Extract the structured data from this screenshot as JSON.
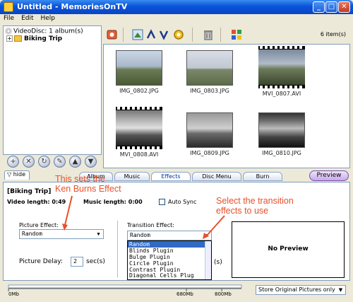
{
  "window": {
    "title": "Untitled - MemoriesOnTV"
  },
  "menu": [
    "File",
    "Edit",
    "Help"
  ],
  "tree": {
    "root": "VideoDisc: 1 album(s)",
    "album": "Biking Trip"
  },
  "toolbar": {
    "item_count": "6 item(s)"
  },
  "thumbnails": [
    {
      "name": "IMG_0802.JPG",
      "type": "photo"
    },
    {
      "name": "IMG_0803.JPG",
      "type": "photo"
    },
    {
      "name": "MVI_0807.AVI",
      "type": "video"
    },
    {
      "name": "MVI_0808.AVI",
      "type": "video"
    },
    {
      "name": "IMG_0809.JPG",
      "type": "photo"
    },
    {
      "name": "IMG_0810.JPG",
      "type": "photo"
    }
  ],
  "hide_tab": "hide",
  "tabs": [
    "Album",
    "Music",
    "Effects",
    "Disc Menu",
    "Burn"
  ],
  "active_tab": "Effects",
  "preview_button": "Preview",
  "album_panel": {
    "title": "[Biking Trip]",
    "video_length": "Video length: 0:49",
    "music_length": "Music length: 0:00",
    "auto_sync": "Auto Sync"
  },
  "effects": {
    "picture_effect_label": "Picture Effect:",
    "picture_effect_value": "Random",
    "picture_delay_label": "Picture Delay:",
    "picture_delay_value": "2",
    "picture_delay_unit": "sec(s)",
    "transition_effect_label": "Transition Effect:",
    "transition_effect_value": "Random",
    "transition_options": [
      "Random",
      "Blinds Plugin",
      "Bulge Plugin",
      "Circle Plugin",
      "Contrast Plugin",
      "Diagonal Cells Plug"
    ],
    "transition_suffix": "(s)",
    "no_preview": "No Preview"
  },
  "capacity": {
    "ticks": [
      "0Mb",
      "680Mb",
      "800Mb"
    ],
    "used_fraction": 0.0
  },
  "store_option": "Store Original Pictures only",
  "annotations": {
    "ken_burns_line1": "This sets the",
    "ken_burns_line2": "Ken Burns Effect",
    "transition_line1": "Select the transition",
    "transition_line2": "effects to use"
  },
  "colors": {
    "annotation": "#e8502a",
    "titlebar": "#0a53d8",
    "selection": "#316ac5"
  }
}
